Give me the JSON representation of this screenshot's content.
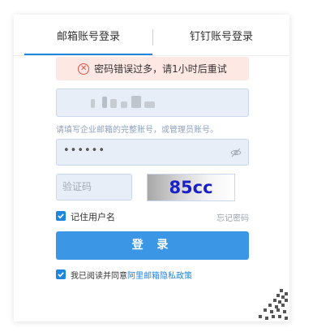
{
  "tabs": {
    "email_login": "邮箱账号登录",
    "dingtalk_login": "钉钉账号登录"
  },
  "alert": {
    "icon": "error-circle-icon",
    "message": "密码错误过多，请1小时后重试"
  },
  "account": {
    "hint": "请填写企业邮箱的完整账号，或管理员账号。"
  },
  "password": {
    "masked_value": "••••••",
    "toggle_icon": "eye-slash-icon"
  },
  "captcha": {
    "placeholder": "验证码",
    "code": "85cc"
  },
  "remember": {
    "label": "记住用户名",
    "checked": true
  },
  "forgot_password": "忘记密码",
  "login_button": "登 录",
  "agreement": {
    "prefix": "我已阅读并同意",
    "link": "阿里邮箱隐私政策",
    "checked": true
  },
  "colors": {
    "accent": "#1f86de",
    "button": "#3b97e6",
    "alert_bg": "#fde8e3",
    "alert_icon": "#e2544c",
    "input_bg": "#e8eef7",
    "captcha_text": "#1a1fc8"
  }
}
